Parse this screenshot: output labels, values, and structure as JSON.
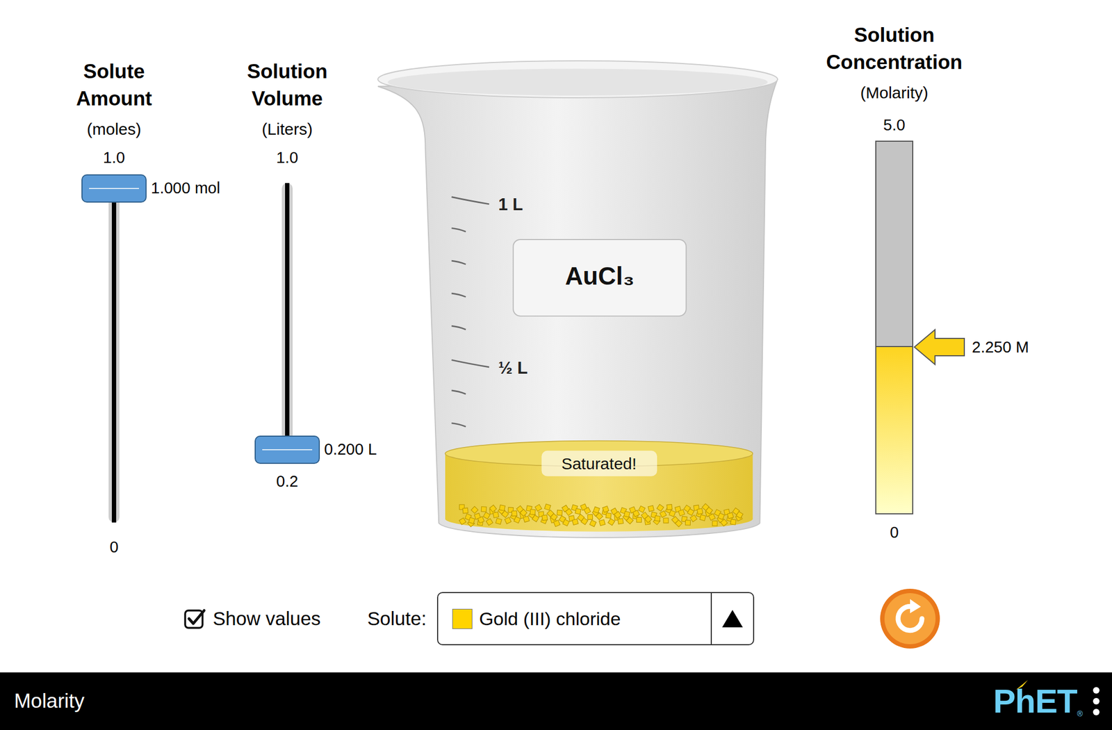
{
  "sliders": [
    {
      "title": "Solute Amount",
      "unit": "(moles)",
      "max": "1.0",
      "min": "0",
      "reading": "1.000 mol",
      "level": 1.0,
      "kind": "amount"
    },
    {
      "title": "Solution Volume",
      "unit": "(Liters)",
      "max": "1.0",
      "min": "0.2",
      "reading": "0.200 L",
      "level": 0.0,
      "kind": "volume"
    }
  ],
  "beaker": {
    "marks": [
      "1 L",
      "½ L"
    ],
    "formula": "AuCl₃",
    "status": "Saturated!",
    "saturated": true,
    "liquid_level": 0.2
  },
  "meter": {
    "title": "Solution Concentration",
    "unit": "(Molarity)",
    "max": "5.0",
    "min": "0",
    "reading": "2.250 M",
    "level": 0.45
  },
  "controls": {
    "show_values": {
      "label": "Show values",
      "checked": true
    },
    "solute": {
      "label": "Solute:",
      "value": "Gold (III) chloride",
      "color": "#ffd400"
    }
  },
  "navbar": {
    "title": "Molarity",
    "logo": "PhET",
    "logo_mark": "®"
  }
}
